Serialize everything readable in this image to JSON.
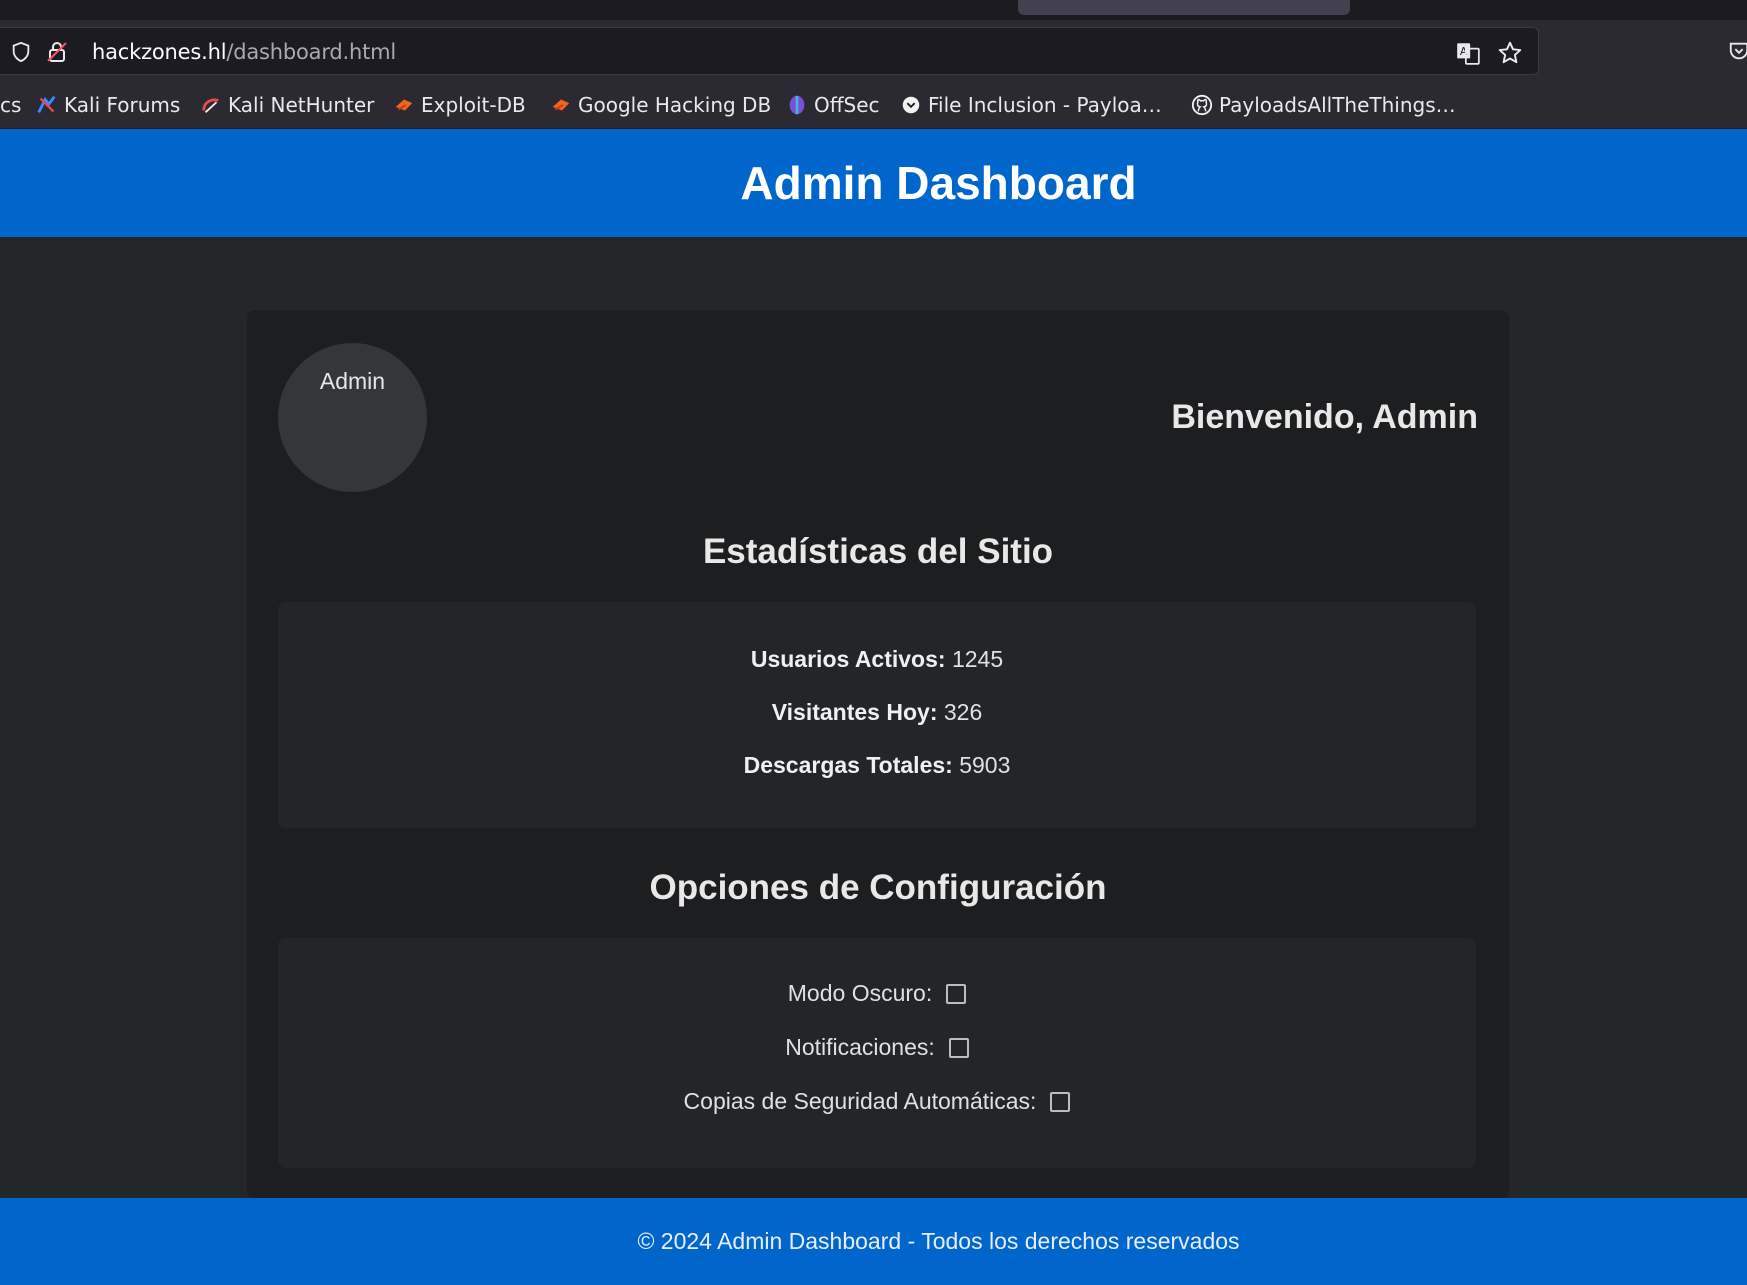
{
  "browser": {
    "url_host": "hackzones.hl",
    "url_path": "/dashboard.html",
    "bookmarks": [
      {
        "label": "cs",
        "icon": "kali-docs-icon"
      },
      {
        "label": "Kali Forums",
        "icon": "kali-forums-icon"
      },
      {
        "label": "Kali NetHunter",
        "icon": "kali-nethunter-icon"
      },
      {
        "label": "Exploit-DB",
        "icon": "exploit-db-icon"
      },
      {
        "label": "Google Hacking DB",
        "icon": "ghdb-icon"
      },
      {
        "label": "OffSec",
        "icon": "offsec-icon"
      },
      {
        "label": "File Inclusion - Payloa…",
        "icon": "payloads-icon"
      },
      {
        "label": "PayloadsAllTheThings…",
        "icon": "github-icon"
      }
    ]
  },
  "header": {
    "title": "Admin Dashboard"
  },
  "profile": {
    "avatar_label": "Admin",
    "welcome": "Bienvenido, Admin"
  },
  "stats": {
    "title": "Estadísticas del Sitio",
    "items": [
      {
        "label": "Usuarios Activos:",
        "value": "1245"
      },
      {
        "label": "Visitantes Hoy:",
        "value": "326"
      },
      {
        "label": "Descargas Totales:",
        "value": "5903"
      }
    ]
  },
  "config": {
    "title": "Opciones de Configuración",
    "options": [
      {
        "label": "Modo Oscuro:",
        "checked": false
      },
      {
        "label": "Notificaciones:",
        "checked": false
      },
      {
        "label": "Copias de Seguridad Automáticas:",
        "checked": false
      }
    ]
  },
  "footer": {
    "text": "© 2024 Admin Dashboard - Todos los derechos reservados"
  },
  "colors": {
    "accent": "#0066cc",
    "page_bg": "#23272a",
    "card_bg": "#1c1e20"
  }
}
